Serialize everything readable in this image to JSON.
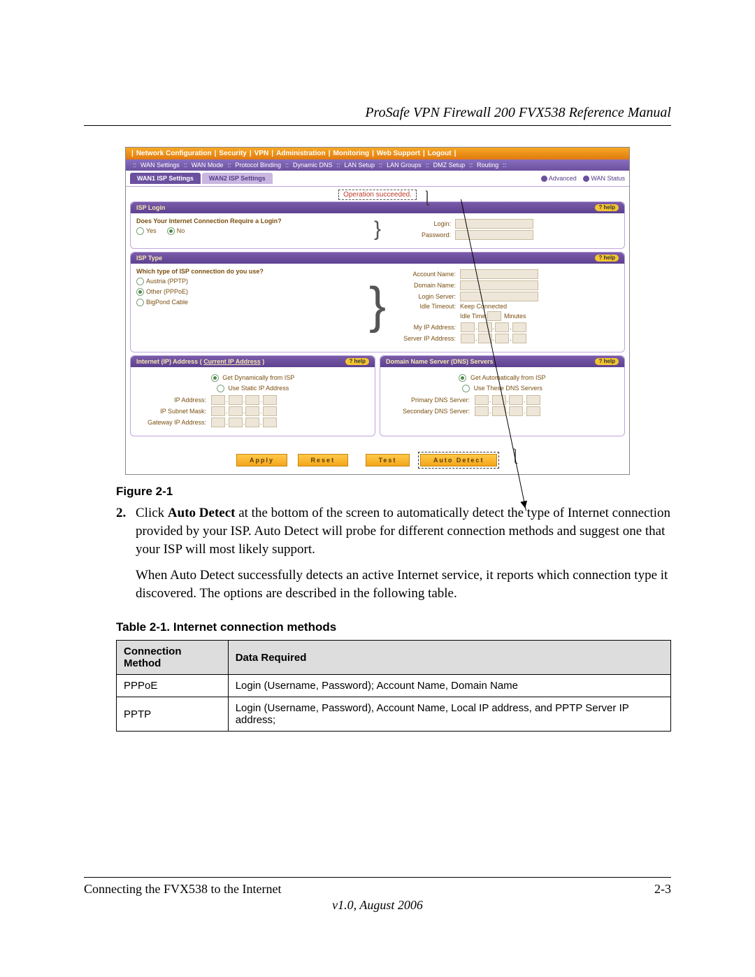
{
  "header": {
    "title": "ProSafe VPN Firewall 200 FVX538 Reference Manual"
  },
  "screenshot": {
    "topnav": [
      "Network Configuration",
      "Security",
      "VPN",
      "Administration",
      "Monitoring",
      "Web Support",
      "Logout"
    ],
    "subnav": [
      "WAN Settings",
      "WAN Mode",
      "Protocol Binding",
      "Dynamic DNS",
      "LAN Setup",
      "LAN Groups",
      "DMZ Setup",
      "Routing"
    ],
    "tabs": {
      "active": "WAN1 ISP Settings",
      "inactive": "WAN2 ISP Settings"
    },
    "links": {
      "advanced": "Advanced",
      "wan_status": "WAN Status"
    },
    "status_message": "Operation succeeded.",
    "isp_login": {
      "title": "ISP Login",
      "help": "help",
      "question": "Does Your Internet Connection Require a Login?",
      "yes": "Yes",
      "no": "No",
      "login_label": "Login:",
      "password_label": "Password:"
    },
    "isp_type": {
      "title": "ISP Type",
      "help": "help",
      "question": "Which type of ISP connection do you use?",
      "opt_pptp": "Austria (PPTP)",
      "opt_pppoe": "Other (PPPoE)",
      "opt_bigpond": "BigPond Cable",
      "account": "Account Name:",
      "domain": "Domain Name:",
      "login_server": "Login Server:",
      "idle_timeout": "Idle Timeout:",
      "keep": "Keep Connected",
      "idle_time": "Idle Time:",
      "minutes": "Minutes",
      "my_ip": "My IP Address:",
      "server_ip": "Server IP Address:"
    },
    "ip_panel": {
      "title": "Internet (IP) Address",
      "link": "Current IP Address",
      "help": "help",
      "dyn": "Get Dynamically from ISP",
      "static": "Use Static IP Address",
      "ip": "IP Address:",
      "mask": "IP Subnet Mask:",
      "gw": "Gateway IP Address:"
    },
    "dns_panel": {
      "title": "Domain Name Server (DNS) Servers",
      "help": "help",
      "auto": "Get Automatically from ISP",
      "these": "Use These DNS Servers",
      "primary": "Primary DNS Server:",
      "secondary": "Secondary DNS Server:"
    },
    "buttons": {
      "apply": "Apply",
      "reset": "Reset",
      "test": "Test",
      "auto": "Auto Detect"
    }
  },
  "figure_caption": "Figure 2-1",
  "step2": {
    "num": "2.",
    "prefix": "Click ",
    "bold": "Auto Detect",
    "rest": " at the bottom of the screen to automatically detect the type of Internet connection provided by your ISP. Auto Detect will probe for different connection methods and suggest one that your ISP will most likely support."
  },
  "para2": "When Auto Detect successfully detects an active Internet service, it reports which connection type it discovered. The options are described in the following table.",
  "table": {
    "caption": "Table 2-1. Internet connection methods",
    "head": [
      "Connection Method",
      "Data Required"
    ],
    "rows": [
      [
        "PPPoE",
        "Login (Username, Password); Account Name, Domain Name"
      ],
      [
        "PPTP",
        "Login (Username, Password), Account Name, Local IP address, and PPTP Server IP address;"
      ]
    ]
  },
  "footer": {
    "left": "Connecting the FVX538 to the Internet",
    "right": "2-3",
    "version": "v1.0, August 2006"
  }
}
